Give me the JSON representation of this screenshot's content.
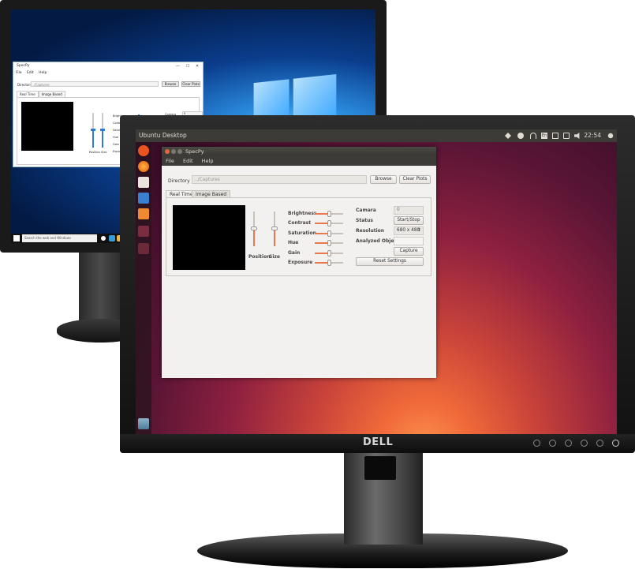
{
  "windows_monitor": {
    "app": {
      "title": "SpecPy",
      "window_controls": [
        "—",
        "☐",
        "✕"
      ],
      "menu": [
        "File",
        "Edit",
        "Help"
      ],
      "directory_label": "Directory",
      "directory_value": "./Captures",
      "browse_label": "Browse",
      "clear_plots_label": "Clear Plots",
      "tabs": [
        "Real Time",
        "Image Based"
      ],
      "slider_labels": [
        "Brightness",
        "Contrast",
        "Saturation",
        "Hue",
        "Gain",
        "Exposure"
      ],
      "position_size_label": "Position Size",
      "camera_label": "Camera",
      "camera_value": "0",
      "status_label": "Status",
      "start_stop_label": "Start/Stop"
    },
    "taskbar": {
      "search_placeholder": "Search the web and Windows"
    }
  },
  "ubuntu_monitor": {
    "topbar": {
      "title": "Ubuntu Desktop",
      "clock": "22:54",
      "keyboard_indicator": "En"
    },
    "launcher_icons": [
      "ubuntu-dash-icon",
      "firefox-icon",
      "files-icon",
      "writer-icon",
      "software-center-icon",
      "system-settings-icon",
      "trash-icon",
      "workspace-icon"
    ],
    "app": {
      "title": "SpecPy",
      "menu": [
        "File",
        "Edit",
        "Help"
      ],
      "directory_label": "Directory",
      "directory_value": "../Captures",
      "browse_label": "Browse",
      "clear_plots_label": "Clear Plots",
      "tabs": [
        "Real Time",
        "Image Based"
      ],
      "position_label": "Position",
      "size_label": "Size",
      "sliders": [
        {
          "label": "Brightness",
          "value": 0.5
        },
        {
          "label": "Contrast",
          "value": 0.5
        },
        {
          "label": "Saturation",
          "value": 0.5
        },
        {
          "label": "Hue",
          "value": 0.5
        },
        {
          "label": "Gain",
          "value": 0.5
        },
        {
          "label": "Exposure",
          "value": 0.5
        }
      ],
      "position_value": 0.5,
      "size_value": 0.5,
      "camera_label": "Camara",
      "camera_value": "0",
      "status_label": "Status",
      "start_stop_label": "Start/Stop",
      "resolution_label": "Resolution",
      "resolution_value": "680 x 480",
      "analyzed_object_label": "Analyzed Object",
      "capture_label": "Capture",
      "reset_settings_label": "Reset Settings"
    },
    "brand": "DELL",
    "accent_color": "#e8784d"
  }
}
